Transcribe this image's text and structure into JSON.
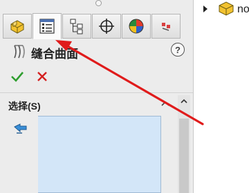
{
  "panel": {
    "title": "缝合曲面",
    "help_label": "?",
    "tabs": [
      {
        "name": "feature-manager-tab",
        "icon": "part-icon"
      },
      {
        "name": "property-manager-tab",
        "icon": "property-list-icon",
        "active": true
      },
      {
        "name": "configuration-manager-tab",
        "icon": "configuration-icon"
      },
      {
        "name": "dimxpert-manager-tab",
        "icon": "crosshair-icon"
      },
      {
        "name": "display-manager-tab",
        "icon": "appearance-sphere-icon"
      },
      {
        "name": "extra-tab",
        "icon": "tool-icon"
      }
    ]
  },
  "selection": {
    "header": "选择(S)"
  },
  "tree": {
    "item_text": "no"
  },
  "colors": {
    "accent_blue": "#5ea6e8",
    "selection_fill": "#d3e6f8",
    "annotation_red": "#e01b1b",
    "ok_green": "#2f9e2f",
    "cancel_red": "#d42020"
  }
}
